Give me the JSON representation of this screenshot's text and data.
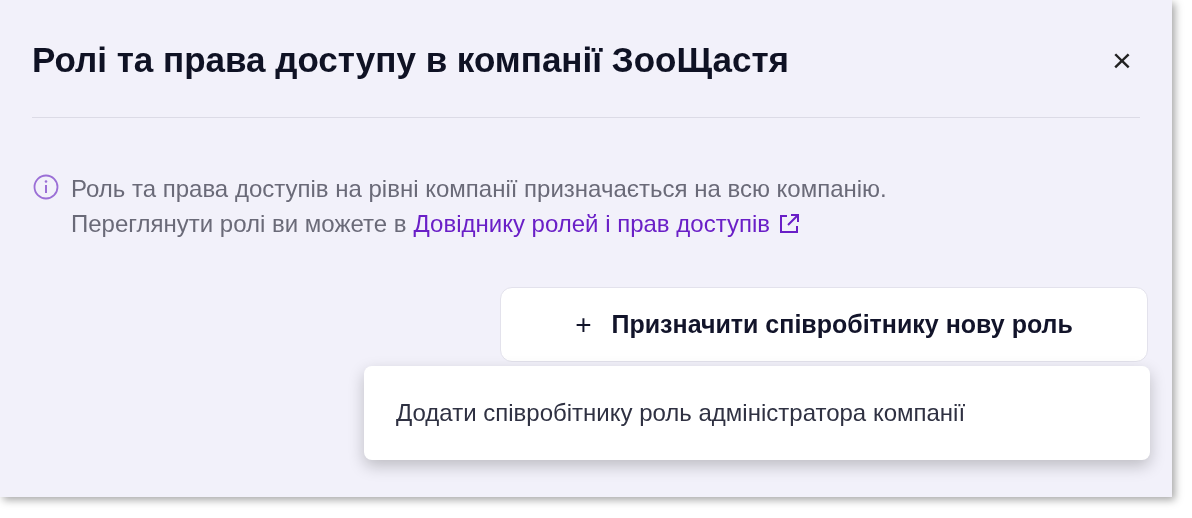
{
  "dialog": {
    "title": "Ролі та права доступу в компанії ЗооЩастя",
    "close": "×"
  },
  "info": {
    "text": "Роль та права доступів на рівні компанії призначається на всю компанію.",
    "text2": "Переглянути ролі ви можете в",
    "link": "Довіднику ролей і прав доступів"
  },
  "assign_button": {
    "icon": "+",
    "label": "Призначити співробітнику нову роль",
    "expanded": true
  },
  "menu": {
    "items": [
      {
        "label": "Додати співробітнику роль адміністратора компанії"
      }
    ]
  }
}
